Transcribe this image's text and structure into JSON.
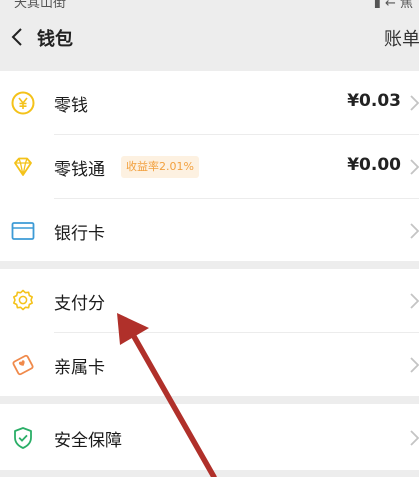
{
  "status_bar": {
    "left": "天其山街",
    "right": "▮ ← 焦"
  },
  "nav": {
    "title": "钱包",
    "right_label": "账单"
  },
  "wallet": {
    "items": [
      {
        "label": "零钱",
        "value": "¥0.03",
        "icon": "yen-coin-icon"
      },
      {
        "label": "零钱通",
        "badge": "收益率2.01%",
        "value": "¥0.00",
        "icon": "diamond-icon"
      },
      {
        "label": "银行卡",
        "icon": "bank-card-icon"
      }
    ]
  },
  "services": {
    "items": [
      {
        "label": "支付分",
        "icon": "payscore-badge-icon"
      },
      {
        "label": "亲属卡",
        "icon": "family-card-icon"
      }
    ]
  },
  "security": {
    "items": [
      {
        "label": "安全保障",
        "icon": "shield-check-icon"
      }
    ]
  },
  "colors": {
    "accent_yellow": "#f4c21a",
    "accent_blue": "#3d9bd6",
    "accent_orange": "#f08a4b",
    "accent_green": "#2aae67",
    "annotation_red": "#b0302a"
  }
}
